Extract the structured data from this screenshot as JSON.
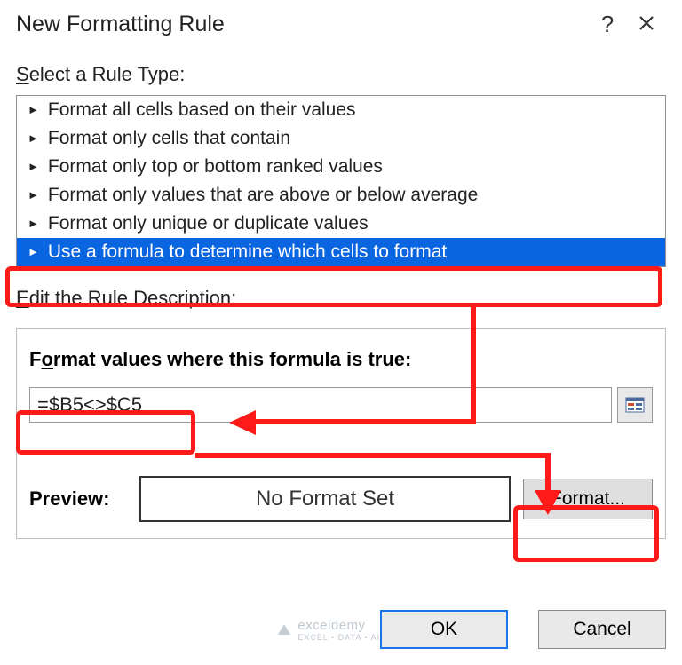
{
  "dialog": {
    "title": "New Formatting Rule"
  },
  "labels": {
    "select_rule_prefix": "S",
    "select_rule_rest": "elect a Rule Type:",
    "edit_rule_prefix": "E",
    "edit_rule_rest": "dit the Rule Description:",
    "formula_prefix": "F",
    "formula_mid_o": "o",
    "formula_rest1": "rmat values where this formula is true:",
    "preview": "Preview:",
    "preview_value": "No Format Set",
    "format_btn_prefix": "F",
    "format_btn_rest": "ormat...",
    "ok": "OK",
    "cancel": "Cancel"
  },
  "rule_types": [
    "Format all cells based on their values",
    "Format only cells that contain",
    "Format only top or bottom ranked values",
    "Format only values that are above or below average",
    "Format only unique or duplicate values",
    "Use a formula to determine which cells to format"
  ],
  "selected_rule_index": 5,
  "formula_value": "=$B5<>$C5",
  "watermark": {
    "brand": "exceldemy",
    "tag": "EXCEL • DATA • AI"
  },
  "colors": {
    "selection": "#0a66e0",
    "annotation": "#ff1a1a",
    "ok_border": "#1a73e8"
  }
}
